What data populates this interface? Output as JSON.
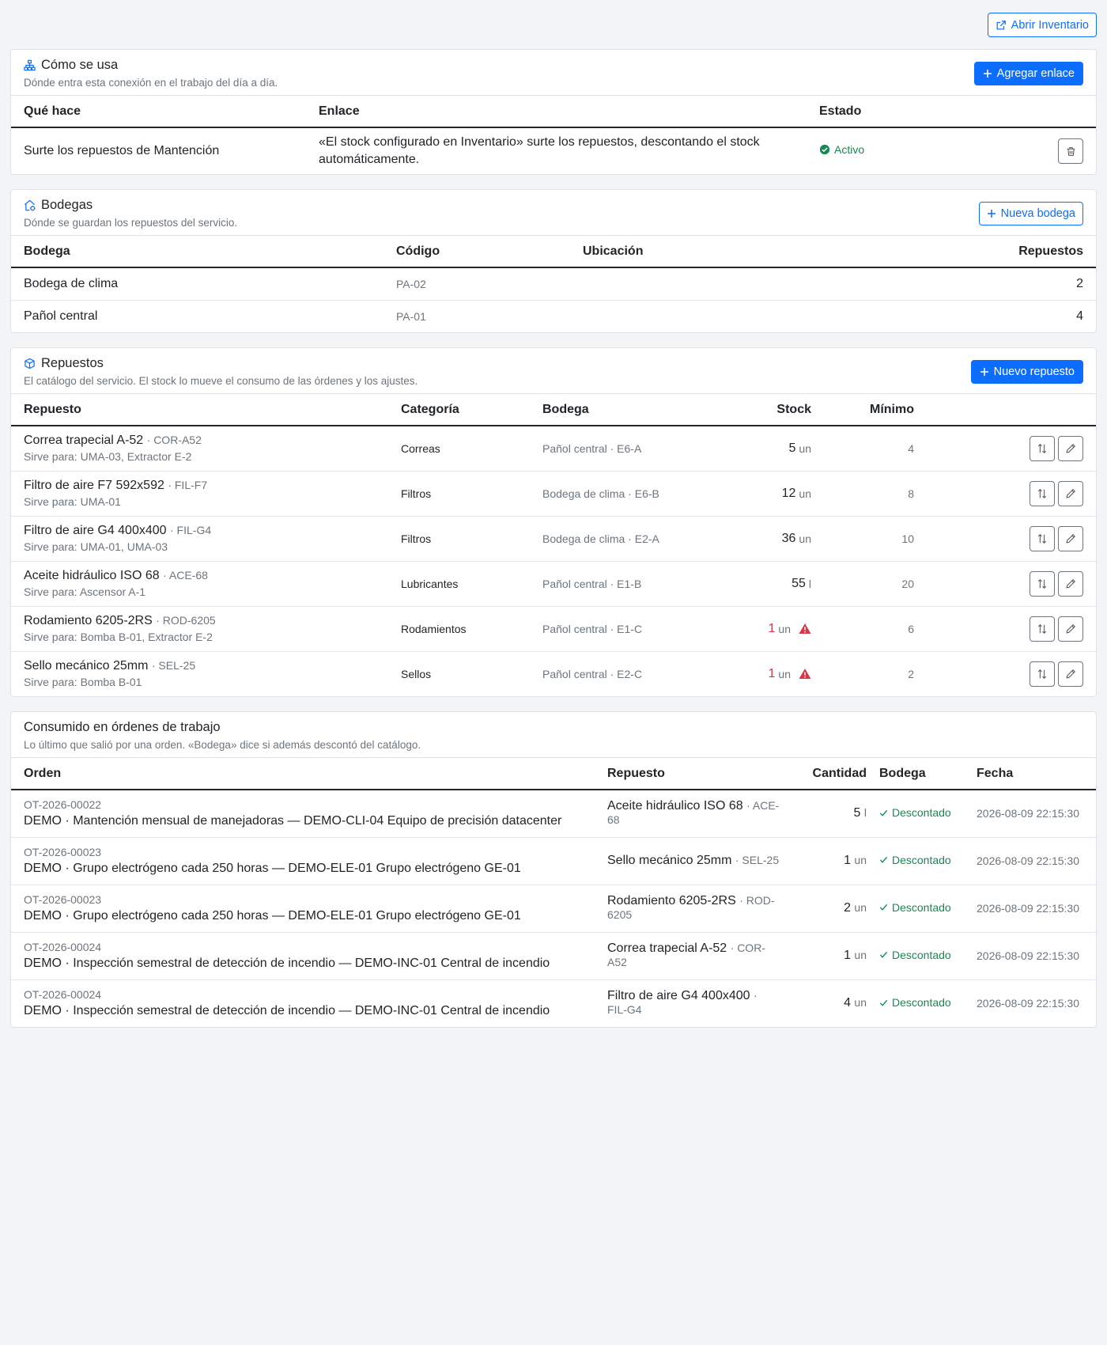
{
  "topbar": {
    "open_inventory_label": "Abrir Inventario"
  },
  "como": {
    "title": "Cómo se usa",
    "subtitle": "Dónde entra esta conexión en el trabajo del día a día.",
    "add_label": "Agregar enlace",
    "headers": [
      "Qué hace",
      "Enlace",
      "Estado"
    ],
    "rows": [
      {
        "what": "Surte los repuestos de Mantención",
        "link": "«El stock configurado en Inventario» surte los repuestos, descontando el stock automáticamente.",
        "status": "Activo"
      }
    ]
  },
  "bodegas": {
    "title": "Bodegas",
    "subtitle": "Dónde se guardan los repuestos del servicio.",
    "new_label": "Nueva bodega",
    "headers": [
      "Bodega",
      "Código",
      "Ubicación",
      "Repuestos"
    ],
    "rows": [
      {
        "name": "Bodega de clima",
        "code": "PA-02",
        "location": "",
        "count": "2"
      },
      {
        "name": "Pañol central",
        "code": "PA-01",
        "location": "",
        "count": "4"
      }
    ]
  },
  "repuestos": {
    "title": "Repuestos",
    "subtitle": "El catálogo del servicio. El stock lo mueve el consumo de las órdenes y los ajustes.",
    "new_label": "Nuevo repuesto",
    "headers": [
      "Repuesto",
      "Categoría",
      "Bodega",
      "Stock",
      "Mínimo"
    ],
    "rows": [
      {
        "name": "Correa trapecial A-52",
        "code": "· COR-A52",
        "use": "Sirve para: UMA-03, Extractor E-2",
        "category": "Correas",
        "bodega": "Pañol central · E6-A",
        "stock": "5",
        "unit": "un",
        "low": false,
        "min": "4"
      },
      {
        "name": "Filtro de aire F7 592x592",
        "code": "· FIL-F7",
        "use": "Sirve para: UMA-01",
        "category": "Filtros",
        "bodega": "Bodega de clima · E6-B",
        "stock": "12",
        "unit": "un",
        "low": false,
        "min": "8"
      },
      {
        "name": "Filtro de aire G4 400x400",
        "code": "· FIL-G4",
        "use": "Sirve para: UMA-01, UMA-03",
        "category": "Filtros",
        "bodega": "Bodega de clima · E2-A",
        "stock": "36",
        "unit": "un",
        "low": false,
        "min": "10"
      },
      {
        "name": "Aceite hidráulico ISO 68",
        "code": "· ACE-68",
        "use": "Sirve para: Ascensor A-1",
        "category": "Lubricantes",
        "bodega": "Pañol central · E1-B",
        "stock": "55",
        "unit": "l",
        "low": false,
        "min": "20"
      },
      {
        "name": "Rodamiento 6205-2RS",
        "code": "· ROD-6205",
        "use": "Sirve para: Bomba B-01, Extractor E-2",
        "category": "Rodamientos",
        "bodega": "Pañol central · E1-C",
        "stock": "1",
        "unit": "un",
        "low": true,
        "min": "6"
      },
      {
        "name": "Sello mecánico 25mm",
        "code": "· SEL-25",
        "use": "Sirve para: Bomba B-01",
        "category": "Sellos",
        "bodega": "Pañol central · E2-C",
        "stock": "1",
        "unit": "un",
        "low": true,
        "min": "2"
      }
    ]
  },
  "consumo": {
    "title": "Consumido en órdenes de trabajo",
    "subtitle": "Lo último que salió por una orden. «Bodega» dice si además descontó del catálogo.",
    "headers": [
      "Orden",
      "Repuesto",
      "Cantidad",
      "Bodega",
      "Fecha"
    ],
    "rows": [
      {
        "ot": "OT-2026-00022",
        "desc": "DEMO · Mantención mensual de manejadoras — DEMO-CLI-04 Equipo de precisión datacenter",
        "part": "Aceite hidráulico ISO 68",
        "code": "· ACE-68",
        "qty": "5",
        "unit": "l",
        "status": "Descontado",
        "date": "2026-08-09 22:15:30"
      },
      {
        "ot": "OT-2026-00023",
        "desc": "DEMO · Grupo electrógeno cada 250 horas — DEMO-ELE-01 Grupo electrógeno GE-01",
        "part": "Sello mecánico 25mm",
        "code": "· SEL-25",
        "qty": "1",
        "unit": "un",
        "status": "Descontado",
        "date": "2026-08-09 22:15:30"
      },
      {
        "ot": "OT-2026-00023",
        "desc": "DEMO · Grupo electrógeno cada 250 horas — DEMO-ELE-01 Grupo electrógeno GE-01",
        "part": "Rodamiento 6205-2RS",
        "code": "· ROD-6205",
        "qty": "2",
        "unit": "un",
        "status": "Descontado",
        "date": "2026-08-09 22:15:30"
      },
      {
        "ot": "OT-2026-00024",
        "desc": "DEMO · Inspección semestral de detección de incendio — DEMO-INC-01 Central de incendio",
        "part": "Correa trapecial A-52",
        "code": "· COR-A52",
        "qty": "1",
        "unit": "un",
        "status": "Descontado",
        "date": "2026-08-09 22:15:30"
      },
      {
        "ot": "OT-2026-00024",
        "desc": "DEMO · Inspección semestral de detección de incendio — DEMO-INC-01 Central de incendio",
        "part": "Filtro de aire G4 400x400",
        "code": "· FIL-G4",
        "qty": "4",
        "unit": "un",
        "status": "Descontado",
        "date": "2026-08-09 22:15:30"
      }
    ]
  },
  "colors": {
    "primary": "#0d6efd",
    "success": "#198754",
    "danger": "#dc3545",
    "muted": "#6c757d"
  }
}
